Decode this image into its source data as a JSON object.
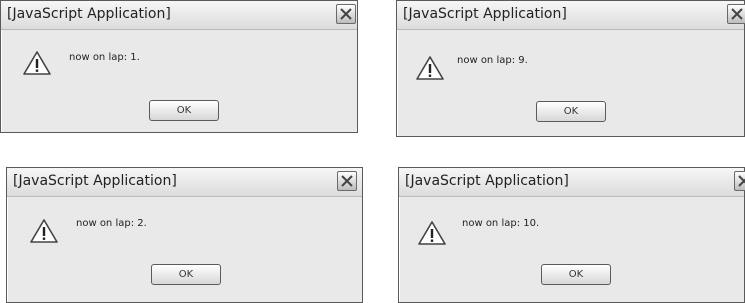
{
  "dialogs": [
    {
      "title": "[JavaScript Application]",
      "message": "now on lap: 1.",
      "ok_label": "OK"
    },
    {
      "title": "[JavaScript Application]",
      "message": "now on lap: 9.",
      "ok_label": "OK"
    },
    {
      "title": "[JavaScript Application]",
      "message": "now on lap: 2.",
      "ok_label": "OK"
    },
    {
      "title": "[JavaScript Application]",
      "message": "now on lap: 10.",
      "ok_label": "OK"
    }
  ],
  "icons": {
    "warning": "warning-icon",
    "close": "close-icon"
  }
}
